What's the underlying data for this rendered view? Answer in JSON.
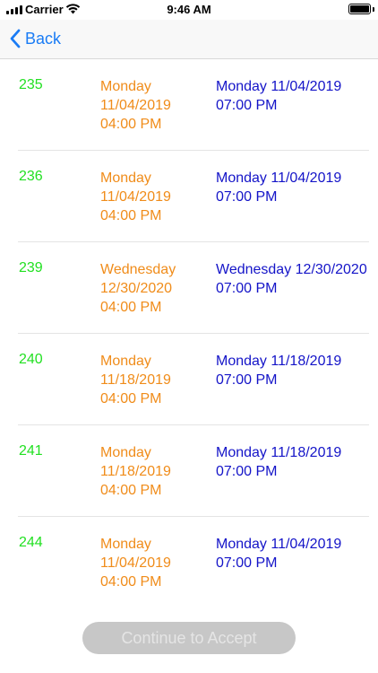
{
  "status_bar": {
    "carrier": "Carrier",
    "time": "9:46 AM",
    "icons": [
      "signal-icon",
      "wifi-icon",
      "battery-icon"
    ]
  },
  "nav": {
    "back_label": "Back"
  },
  "rows": [
    {
      "id": "235",
      "start": "Monday 11/04/2019 04:00 PM",
      "end": "Monday 11/04/2019 07:00 PM"
    },
    {
      "id": "236",
      "start": "Monday 11/04/2019 04:00 PM",
      "end": "Monday 11/04/2019 07:00 PM"
    },
    {
      "id": "239",
      "start": "Wednesday 12/30/2020 04:00 PM",
      "end": "Wednesday 12/30/2020 07:00 PM"
    },
    {
      "id": "240",
      "start": "Monday 11/18/2019 04:00 PM",
      "end": "Monday 11/18/2019 07:00 PM"
    },
    {
      "id": "241",
      "start": "Monday 11/18/2019 04:00 PM",
      "end": "Monday 11/18/2019 07:00 PM"
    },
    {
      "id": "244",
      "start": "Monday 11/04/2019 04:00 PM",
      "end": "Monday 11/04/2019 07:00 PM"
    }
  ],
  "colors": {
    "id": "#22e022",
    "start": "#f08c1a",
    "end": "#1414c8",
    "accent": "#1a7cf5"
  },
  "continue_label": "Continue to Accept"
}
